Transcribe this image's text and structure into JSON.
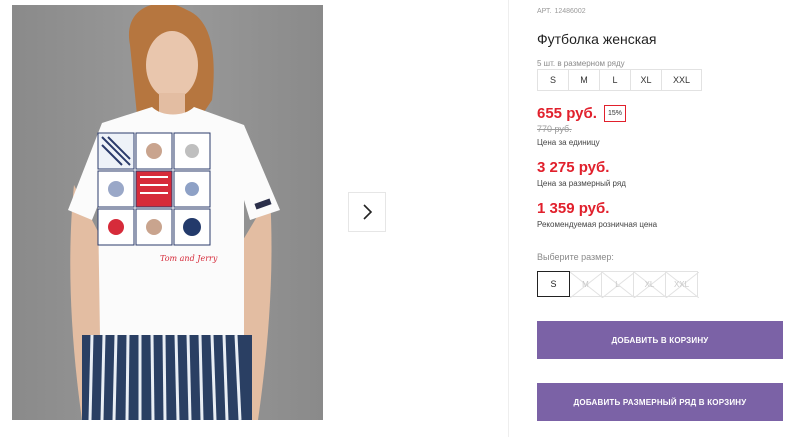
{
  "product": {
    "sku_label": "АРТ.",
    "sku": "12486002",
    "title": "Футболка женская",
    "pack_caption": "5 шт. в размерном ряду",
    "pack_sizes": [
      "S",
      "M",
      "L",
      "XL",
      "XXL"
    ],
    "price": "655 руб.",
    "discount": "15%",
    "old_price": "770 руб.",
    "price_caption": "Цена за единицу",
    "pack_price": "3 275 руб.",
    "pack_price_caption": "Цена за размерный ряд",
    "retail_price": "1 359 руб.",
    "retail_price_caption": "Рекомендуемая розничная цена",
    "choose_label": "Выберите размер:",
    "size_options": [
      {
        "label": "S",
        "state": "selected"
      },
      {
        "label": "M",
        "state": "unavailable"
      },
      {
        "label": "L",
        "state": "unavailable"
      },
      {
        "label": "XL",
        "state": "unavailable"
      },
      {
        "label": "XXL",
        "state": "unavailable"
      }
    ],
    "add_to_cart": "ДОБАВИТЬ В КОРЗИНУ",
    "add_pack_to_cart": "ДОБАВИТЬ РАЗМЕРНЫЙ РЯД В КОРЗИНУ"
  },
  "gallery": {
    "next_icon": "chevron-right-icon",
    "print_text": "Tom and Jerry"
  },
  "colors": {
    "accent_button": "#7b62a6",
    "price_red": "#e1202c"
  }
}
